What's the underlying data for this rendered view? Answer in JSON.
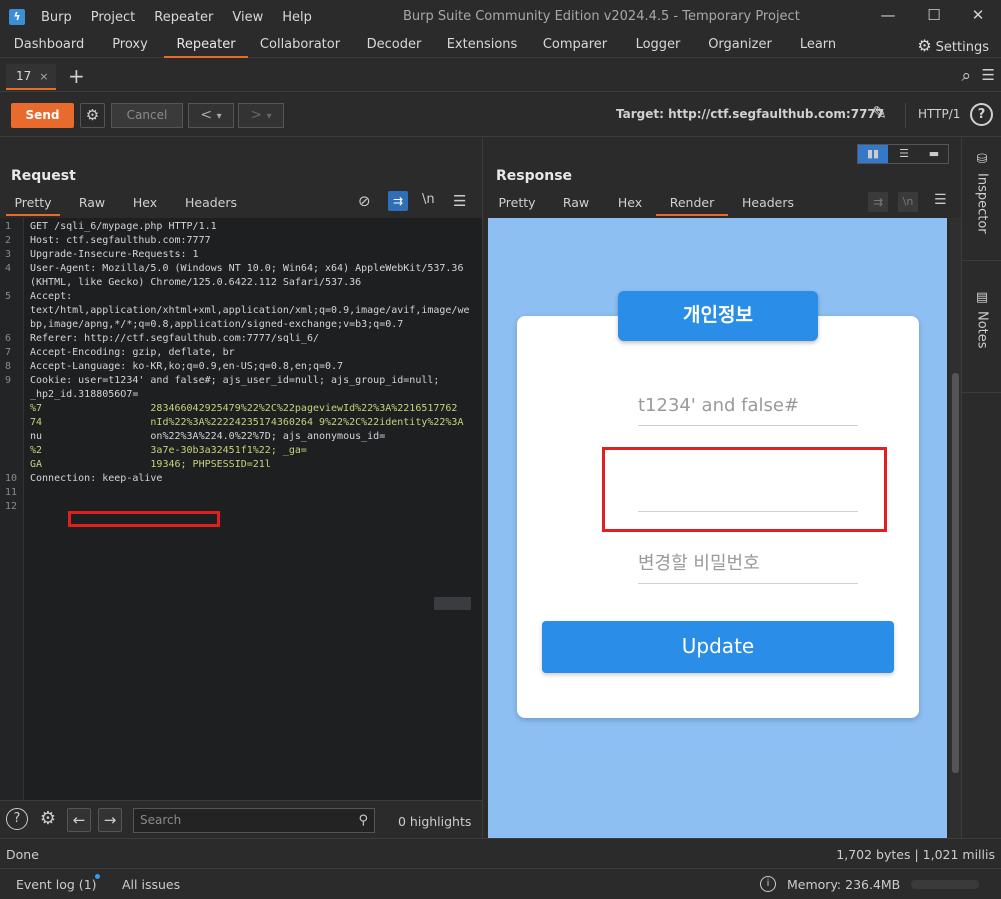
{
  "app": {
    "title": "Burp Suite Community Edition v2024.4.5 - Temporary Project",
    "logo": "burp-logo",
    "menu": [
      "Burp",
      "Project",
      "Repeater",
      "View",
      "Help"
    ]
  },
  "main_tabs": [
    {
      "label": "Dashboard"
    },
    {
      "label": "Proxy"
    },
    {
      "label": "Repeater",
      "active": true
    },
    {
      "label": "Collaborator"
    },
    {
      "label": "Decoder"
    },
    {
      "label": "Extensions"
    },
    {
      "label": "Comparer"
    },
    {
      "label": "Logger"
    },
    {
      "label": "Organizer"
    },
    {
      "label": "Learn"
    }
  ],
  "settings_label": "Settings",
  "repeater_tab": {
    "label": "17",
    "close": "×"
  },
  "toolbar": {
    "send": "Send",
    "cancel": "Cancel",
    "target": "Target: http://ctf.segfaulthub.com:7777",
    "http_version": "HTTP/1",
    "help": "?"
  },
  "request": {
    "title": "Request",
    "tabs": [
      "Pretty",
      "Raw",
      "Hex",
      "Headers"
    ],
    "active_tab": "Pretty",
    "lines": [
      {
        "n": "1",
        "text": "GET /sqli_6/mypage.php HTTP/1.1"
      },
      {
        "n": "2",
        "text": "Host: ctf.segfaulthub.com:7777"
      },
      {
        "n": "3",
        "text": "Upgrade-Insecure-Requests: 1"
      },
      {
        "n": "4",
        "text": "User-Agent: Mozilla/5.0 (Windows NT 10.0; Win64; x64) AppleWebKit/537.36"
      },
      {
        "n": "",
        "text": "(KHTML, like Gecko) Chrome/125.0.6422.112 Safari/537.36"
      },
      {
        "n": "5",
        "text": "Accept:"
      },
      {
        "n": "",
        "text": "text/html,application/xhtml+xml,application/xml;q=0.9,image/avif,image/we"
      },
      {
        "n": "",
        "text": "bp,image/apng,*/*;q=0.8,application/signed-exchange;v=b3;q=0.7"
      },
      {
        "n": "6",
        "text": "Referer: http://ctf.segfaulthub.com:7777/sqli_6/"
      },
      {
        "n": "7",
        "text": "Accept-Encoding: gzip, deflate, br"
      },
      {
        "n": "8",
        "text": "Accept-Language: ko-KR,ko;q=0.9,en-US;q=0.8,en;q=0.7"
      },
      {
        "n": "9",
        "text": "Cookie: user=t1234' and false#; ajs_user_id=null; ajs_group_id=null;"
      },
      {
        "n": "",
        "text": "_hp2_id.3188056O7="
      },
      {
        "n": "",
        "text": "%7                  283466042925479%22%2C%22pageviewId%22%3A%2216517762"
      },
      {
        "n": "",
        "text": "74                  nId%22%3A%22224235174360264 9%22%2C%22identity%22%3A"
      },
      {
        "n": "",
        "text": "nu                  on%22%3A%224.0%22%7D; ajs_anonymous_id="
      },
      {
        "n": "",
        "text": "%2                  3a7e-30b3a32451f1%22; _ga="
      },
      {
        "n": "",
        "text": "GA                  19346; PHPSESSID=21l"
      },
      {
        "n": "10",
        "text": "Connection: keep-alive"
      },
      {
        "n": "11",
        "text": ""
      },
      {
        "n": "12",
        "text": ""
      }
    ],
    "search_placeholder": "Search",
    "highlights": "0 highlights"
  },
  "response": {
    "title": "Response",
    "tabs": [
      "Pretty",
      "Raw",
      "Hex",
      "Render",
      "Headers"
    ],
    "active_tab": "Render",
    "render": {
      "card_title": "개인정보",
      "user_field": "t1234' and false#",
      "empty_field": "",
      "password_placeholder": "변경할 비밀번호",
      "update_button": "Update"
    }
  },
  "inspector_label": "Inspector",
  "notes_label": "Notes",
  "status": {
    "left": "Done",
    "right": "1,702 bytes | 1,021 millis"
  },
  "bottom": {
    "event_log": "Event log (1)",
    "all_issues": "All issues",
    "memory": "Memory: 236.4MB"
  },
  "colors": {
    "accent": "#e86a2c",
    "render_bg": "#8dbff2",
    "button_blue": "#2a8ee8",
    "highlight_red": "#e02020"
  }
}
